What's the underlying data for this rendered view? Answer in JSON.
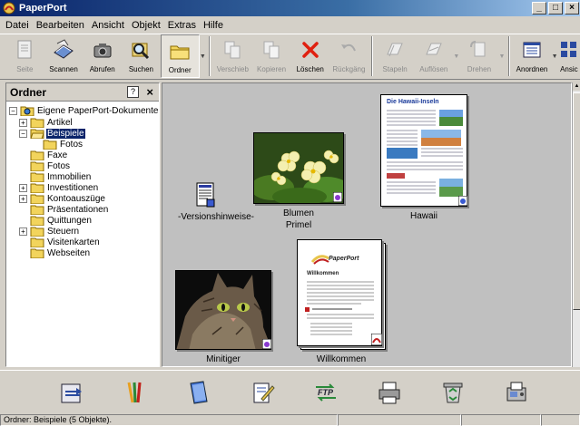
{
  "window": {
    "title": "PaperPort",
    "min": "_",
    "max": "□",
    "close": "×"
  },
  "menu": [
    "Datei",
    "Bearbeiten",
    "Ansicht",
    "Objekt",
    "Extras",
    "Hilfe"
  ],
  "toolbar": {
    "buttons": [
      {
        "label": "Seite",
        "disabled": true
      },
      {
        "label": "Scannen",
        "disabled": false
      },
      {
        "label": "Abrufen",
        "disabled": false
      },
      {
        "label": "Suchen",
        "disabled": false
      },
      {
        "label": "Ordner",
        "disabled": false
      },
      {
        "label": "Verschieb",
        "disabled": true
      },
      {
        "label": "Kopieren",
        "disabled": true
      },
      {
        "label": "Löschen",
        "disabled": false
      },
      {
        "label": "Rückgäng",
        "disabled": true
      },
      {
        "label": "Stapeln",
        "disabled": true
      },
      {
        "label": "Auflösen",
        "disabled": true
      },
      {
        "label": "Drehen",
        "disabled": true
      },
      {
        "label": "Anordnen",
        "disabled": false
      },
      {
        "label": "Ansic",
        "disabled": false
      }
    ]
  },
  "folders": {
    "title": "Ordner",
    "help": "?",
    "close": "×",
    "root": "Eigene PaperPort-Dokumente",
    "items": [
      {
        "label": "Artikel",
        "expander": "+"
      },
      {
        "label": "Beispiele",
        "expander": "−",
        "selected": true
      },
      {
        "label": "Fotos",
        "child": true
      },
      {
        "label": "Faxe"
      },
      {
        "label": "Fotos"
      },
      {
        "label": "Immobilien"
      },
      {
        "label": "Investitionen",
        "expander": "+"
      },
      {
        "label": "Kontoauszüge",
        "expander": "+"
      },
      {
        "label": "Präsentationen"
      },
      {
        "label": "Quittungen"
      },
      {
        "label": "Steuern",
        "expander": "+"
      },
      {
        "label": "Visitenkarten"
      },
      {
        "label": "Webseiten"
      }
    ]
  },
  "documents": [
    {
      "caption": "-Versionshinweise-"
    },
    {
      "caption": "Blumen\nPrimel",
      "line1": "Blumen",
      "line2": "Primel"
    },
    {
      "caption": "Hawaii",
      "heading": "Die Hawaii-Inseln"
    },
    {
      "caption": "Minitiger"
    },
    {
      "caption": "Willkommen",
      "heading": "Willkommen",
      "logo": "PaperPort"
    }
  ],
  "bottombar": [
    "scanner-link-icon",
    "paint-app-icon",
    "notepad-icon",
    "editor-icon",
    "ftp-icon",
    "printer-icon",
    "recycle-icon",
    "fax-icon"
  ],
  "bottom_labels": {
    "ftp": "FTP"
  },
  "status": {
    "text": "Ordner: Beispiele (5 Objekte)."
  }
}
